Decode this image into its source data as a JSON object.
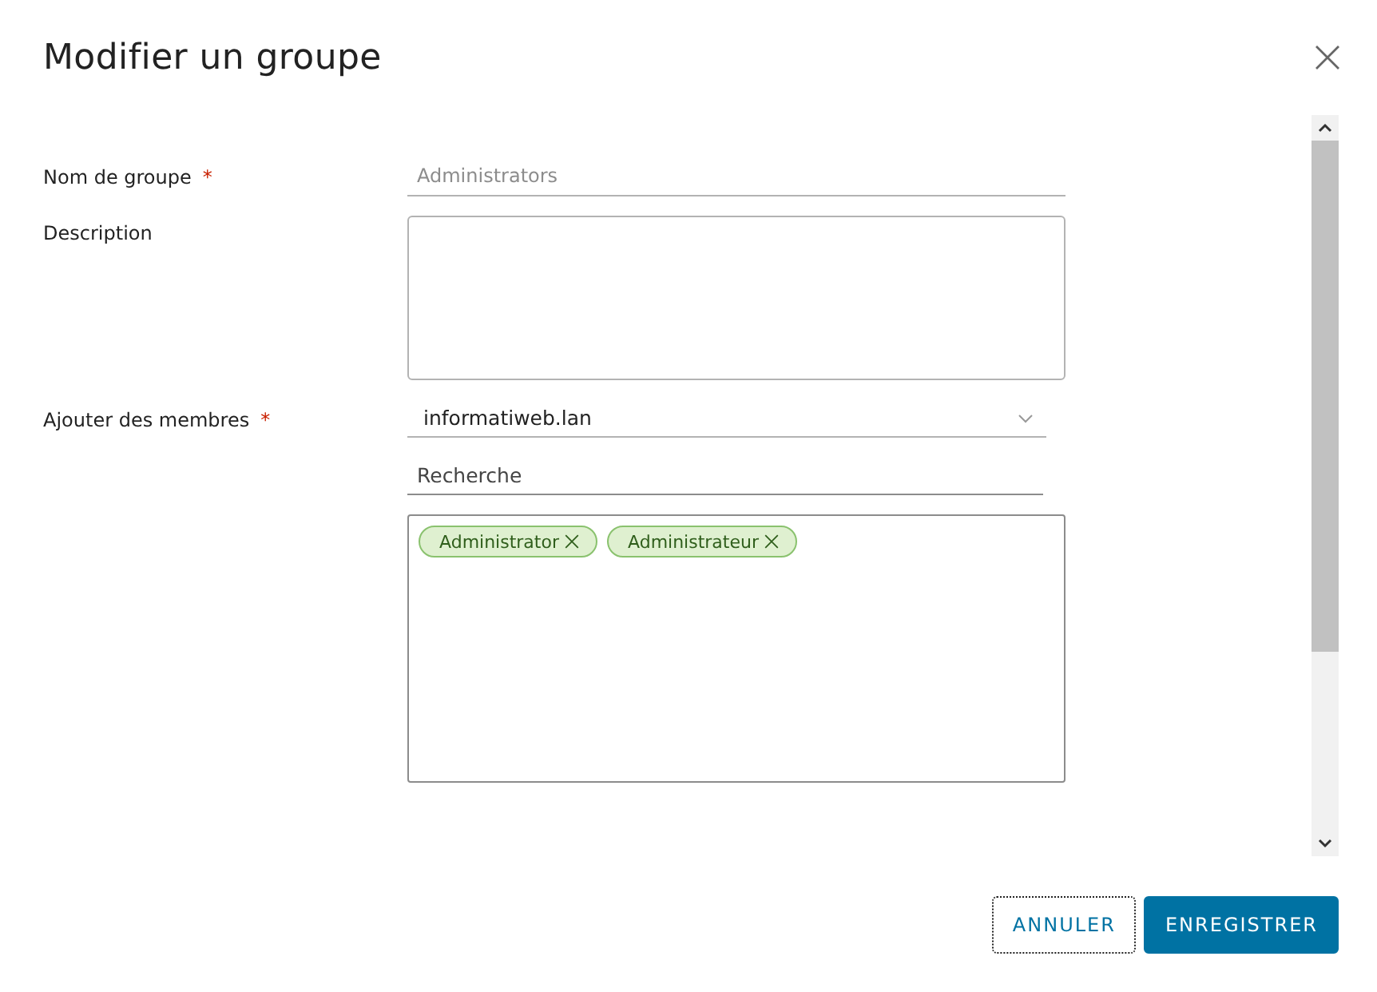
{
  "dialog": {
    "title": "Modifier un groupe"
  },
  "fields": [
    {
      "kind": "text",
      "label": "Nom de groupe",
      "required_mark": "*",
      "value": "Administrators",
      "disabled": true
    },
    {
      "kind": "textarea",
      "label": "Description"
    },
    {
      "kind": "members",
      "label": "Ajouter des membres",
      "required_mark": "*",
      "domain": "informatiweb.lan",
      "search_placeholder": "Recherche",
      "members": [
        {
          "name": "Administrator"
        },
        {
          "name": "Administrateur"
        }
      ]
    }
  ],
  "buttons": [
    {
      "label": "ANNULER",
      "kind": "outline",
      "focused": true
    },
    {
      "label": "ENREGISTRER",
      "kind": "primary",
      "focused": false
    }
  ]
}
